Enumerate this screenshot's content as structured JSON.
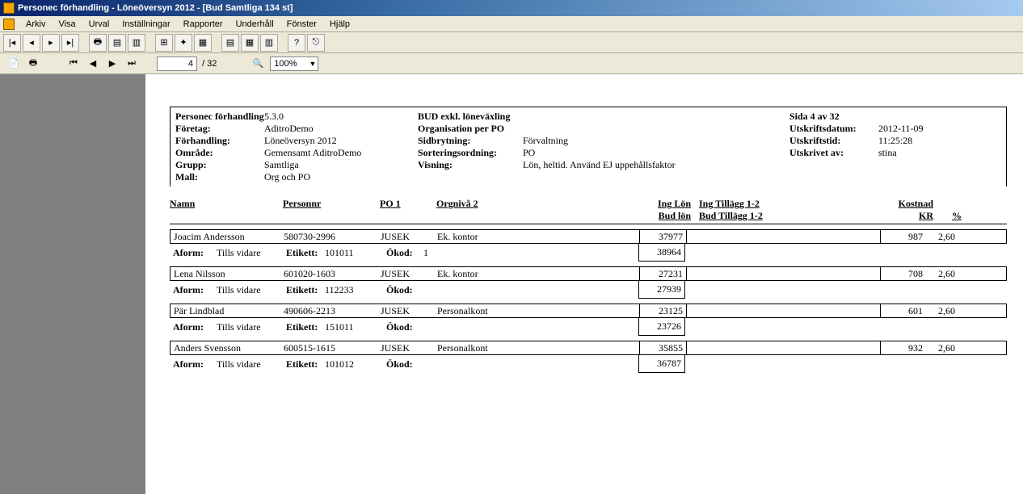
{
  "title": "Personec förhandling - Löneöversyn 2012 - [Bud Samtliga 134 st]",
  "menu": [
    "Arkiv",
    "Visa",
    "Urval",
    "Inställningar",
    "Rapporter",
    "Underhåll",
    "Fönster",
    "Hjälp"
  ],
  "nav": {
    "page_current": "4",
    "page_total": "/ 32",
    "zoom": "100%"
  },
  "report_header": {
    "left": {
      "title_label": "Personec förhandling",
      "title_ver": "5.3.0",
      "foretag_l": "Företag:",
      "foretag_v": "AditroDemo",
      "forh_l": "Förhandling:",
      "forh_v": "Löneöversyn 2012",
      "omr_l": "Område:",
      "omr_v": "Gemensamt AditroDemo",
      "grupp_l": "Grupp:",
      "grupp_v": "Samtliga",
      "mall_l": "Mall:",
      "mall_v": "Org och PO"
    },
    "mid": {
      "r1": "BUD exkl. löneväxling",
      "r2": "Organisation per PO",
      "sid_l": "Sidbrytning:",
      "sid_v": "Förvaltning",
      "sort_l": "Sorteringsordning:",
      "sort_v": "PO",
      "vis_l": "Visning:",
      "vis_v": "Lön, heltid. Använd EJ uppehållsfaktor"
    },
    "right": {
      "sida": "Sida 4 av 32",
      "dat_l": "Utskriftsdatum:",
      "dat_v": "2012-11-09",
      "tid_l": "Utskriftstid:",
      "tid_v": "11:25:28",
      "av_l": "Utskrivet av:",
      "av_v": "stina"
    }
  },
  "col_headers": {
    "namn": "Namn",
    "personnr": "Personnr",
    "po1": "PO 1",
    "orgniva2": "Orgnivå 2",
    "inglon1": "Ing Lön",
    "inglon2": "Bud lön",
    "tillagg1": "Ing Tillägg 1-2",
    "tillagg2": "Bud Tillägg 1-2",
    "kostnad": "Kostnad",
    "kr": "KR",
    "pct": "%"
  },
  "row_labels": {
    "aform": "Aform:",
    "etikett": "Etikett:",
    "okod": "Ökod:"
  },
  "entries": [
    {
      "name": "Joacim Andersson",
      "pnr": "580730-2996",
      "po1": "JUSEK",
      "org2": "Ek. kontor",
      "inglon": "37977",
      "budlon": "38964",
      "kost": "987",
      "pct": "2,60",
      "aform": "Tills vidare",
      "etikett": "101011",
      "okod": "1"
    },
    {
      "name": "Lena Nilsson",
      "pnr": "601020-1603",
      "po1": "JUSEK",
      "org2": "Ek. kontor",
      "inglon": "27231",
      "budlon": "27939",
      "kost": "708",
      "pct": "2,60",
      "aform": "Tills vidare",
      "etikett": "112233",
      "okod": ""
    },
    {
      "name": "Pär Lindblad",
      "pnr": "490606-2213",
      "po1": "JUSEK",
      "org2": "Personalkont",
      "inglon": "23125",
      "budlon": "23726",
      "kost": "601",
      "pct": "2,60",
      "aform": "Tills vidare",
      "etikett": "151011",
      "okod": ""
    },
    {
      "name": "Anders Svensson",
      "pnr": "600515-1615",
      "po1": "JUSEK",
      "org2": "Personalkont",
      "inglon": "35855",
      "budlon": "36787",
      "kost": "932",
      "pct": "2,60",
      "aform": "Tills vidare",
      "etikett": "101012",
      "okod": ""
    }
  ]
}
